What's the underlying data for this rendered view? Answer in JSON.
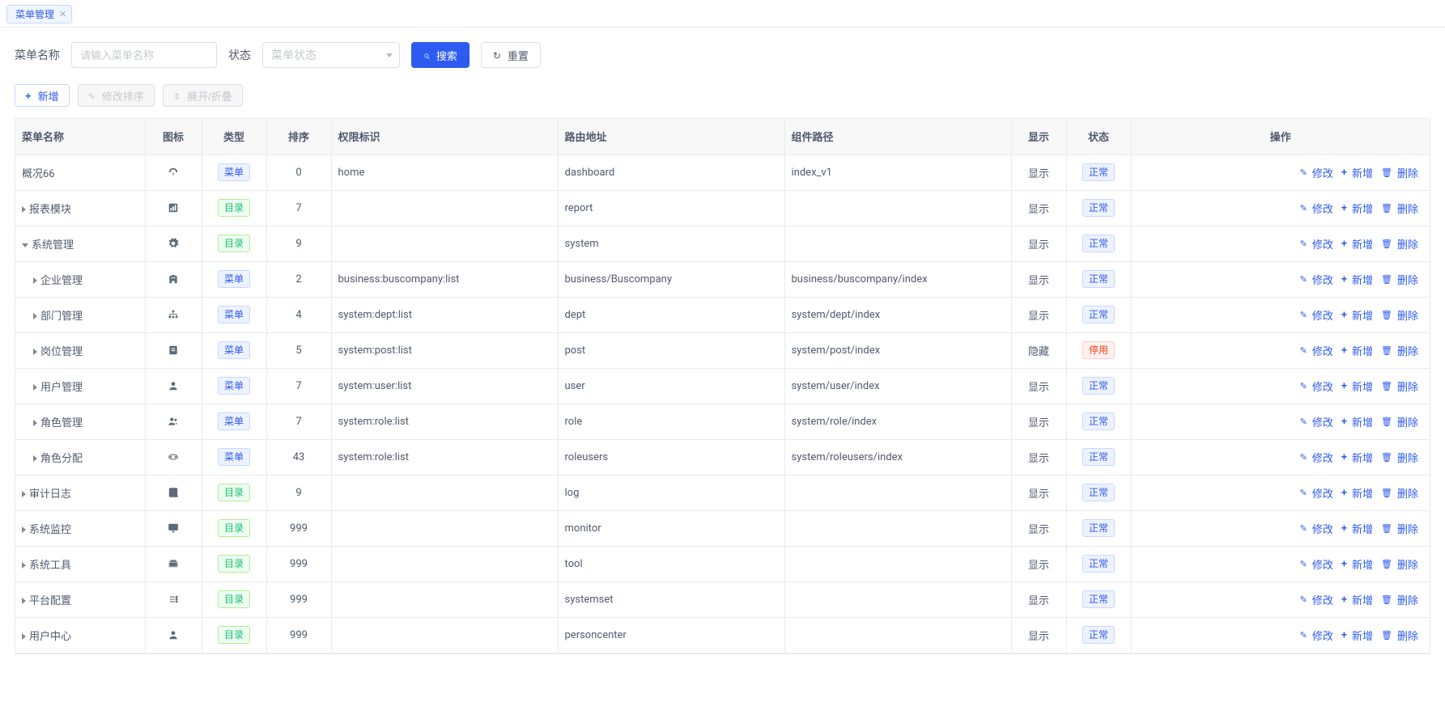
{
  "tab": {
    "label": "菜单管理"
  },
  "search": {
    "name_label": "菜单名称",
    "name_placeholder": "请输入菜单名称",
    "status_label": "状态",
    "status_placeholder": "菜单状态",
    "search_btn": "搜索",
    "reset_btn": "重置"
  },
  "toolbar": {
    "add_btn": "新增",
    "modify_sort_btn": "修改排序",
    "expand_collapse_btn": "展开/折叠"
  },
  "columns": {
    "name": "菜单名称",
    "icon": "图标",
    "type": "类型",
    "sort": "排序",
    "perm": "权限标识",
    "route": "路由地址",
    "component": "组件路径",
    "show": "显示",
    "status": "状态",
    "actions": "操作"
  },
  "labels": {
    "type_menu": "菜单",
    "type_dir": "目录",
    "show_show": "显示",
    "show_hide": "隐藏",
    "status_normal": "正常",
    "status_disabled": "停用",
    "action_edit": "修改",
    "action_add": "新增",
    "action_delete": "删除"
  },
  "rows": [
    {
      "name": "概况66",
      "indent": 0,
      "expandable": false,
      "expanded": false,
      "icon": "dashboard-icon",
      "type": "menu",
      "sort": 0,
      "perm": "home",
      "route": "dashboard",
      "component": "index_v1",
      "show": "show",
      "status": "normal"
    },
    {
      "name": "报表模块",
      "indent": 0,
      "expandable": true,
      "expanded": false,
      "icon": "report-icon",
      "type": "dir",
      "sort": 7,
      "perm": "",
      "route": "report",
      "component": "",
      "show": "show",
      "status": "normal"
    },
    {
      "name": "系统管理",
      "indent": 0,
      "expandable": true,
      "expanded": true,
      "icon": "gear-icon",
      "type": "dir",
      "sort": 9,
      "perm": "",
      "route": "system",
      "component": "",
      "show": "show",
      "status": "normal"
    },
    {
      "name": "企业管理",
      "indent": 1,
      "expandable": true,
      "expanded": false,
      "icon": "building-icon",
      "type": "menu",
      "sort": 2,
      "perm": "business:buscompany:list",
      "route": "business/Buscompany",
      "component": "business/buscompany/index",
      "show": "show",
      "status": "normal"
    },
    {
      "name": "部门管理",
      "indent": 1,
      "expandable": true,
      "expanded": false,
      "icon": "org-icon",
      "type": "menu",
      "sort": 4,
      "perm": "system:dept:list",
      "route": "dept",
      "component": "system/dept/index",
      "show": "show",
      "status": "normal"
    },
    {
      "name": "岗位管理",
      "indent": 1,
      "expandable": true,
      "expanded": false,
      "icon": "post-icon",
      "type": "menu",
      "sort": 5,
      "perm": "system:post:list",
      "route": "post",
      "component": "system/post/index",
      "show": "hide",
      "status": "disabled"
    },
    {
      "name": "用户管理",
      "indent": 1,
      "expandable": true,
      "expanded": false,
      "icon": "user-icon",
      "type": "menu",
      "sort": 7,
      "perm": "system:user:list",
      "route": "user",
      "component": "system/user/index",
      "show": "show",
      "status": "normal"
    },
    {
      "name": "角色管理",
      "indent": 1,
      "expandable": true,
      "expanded": false,
      "icon": "users-icon",
      "type": "menu",
      "sort": 7,
      "perm": "system:role:list",
      "route": "role",
      "component": "system/role/index",
      "show": "show",
      "status": "normal"
    },
    {
      "name": "角色分配",
      "indent": 1,
      "expandable": true,
      "expanded": false,
      "icon": "assign-icon",
      "type": "menu",
      "sort": 43,
      "perm": "system:role:list",
      "route": "roleusers",
      "component": "system/roleusers/index",
      "show": "show",
      "status": "normal"
    },
    {
      "name": "审计日志",
      "indent": 0,
      "expandable": true,
      "expanded": false,
      "icon": "log-icon",
      "type": "dir",
      "sort": 9,
      "perm": "",
      "route": "log",
      "component": "",
      "show": "show",
      "status": "normal"
    },
    {
      "name": "系统监控",
      "indent": 0,
      "expandable": true,
      "expanded": false,
      "icon": "monitor-icon",
      "type": "dir",
      "sort": 999,
      "perm": "",
      "route": "monitor",
      "component": "",
      "show": "show",
      "status": "normal"
    },
    {
      "name": "系统工具",
      "indent": 0,
      "expandable": true,
      "expanded": false,
      "icon": "tool-icon",
      "type": "dir",
      "sort": 999,
      "perm": "",
      "route": "tool",
      "component": "",
      "show": "show",
      "status": "normal"
    },
    {
      "name": "平台配置",
      "indent": 0,
      "expandable": true,
      "expanded": false,
      "icon": "config-icon",
      "type": "dir",
      "sort": 999,
      "perm": "",
      "route": "systemset",
      "component": "",
      "show": "show",
      "status": "normal"
    },
    {
      "name": "用户中心",
      "indent": 0,
      "expandable": true,
      "expanded": false,
      "icon": "person-icon",
      "type": "dir",
      "sort": 999,
      "perm": "",
      "route": "personcenter",
      "component": "",
      "show": "show",
      "status": "normal"
    }
  ]
}
